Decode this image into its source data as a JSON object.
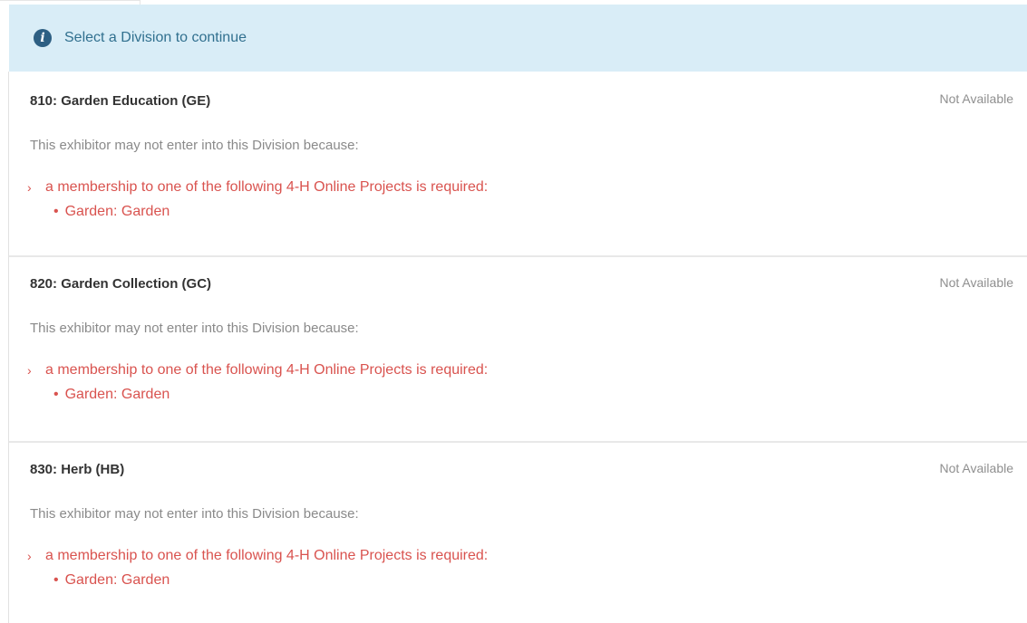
{
  "info": {
    "icon": "info-icon",
    "icon_glyph": "i",
    "message": "Select a Division to continue"
  },
  "divisions": [
    {
      "title": "810: Garden Education (GE)",
      "status": "Not Available",
      "reason_intro": "This exhibitor may not enter into this Division because:",
      "requirement": "a membership to one of the following 4-H Online Projects is required:",
      "projects": [
        "Garden: Garden"
      ]
    },
    {
      "title": "820: Garden Collection (GC)",
      "status": "Not Available",
      "reason_intro": "This exhibitor may not enter into this Division because:",
      "requirement": "a membership to one of the following 4-H Online Projects is required:",
      "projects": [
        "Garden: Garden"
      ]
    },
    {
      "title": "830: Herb (HB)",
      "status": "Not Available",
      "reason_intro": "This exhibitor may not enter into this Division because:",
      "requirement": "a membership to one of the following 4-H Online Projects is required:",
      "projects": [
        "Garden: Garden"
      ]
    }
  ],
  "colors": {
    "info_background": "#d9edf7",
    "info_text": "#31708f",
    "error_text": "#d9534f",
    "muted_text": "#8a8a8a"
  }
}
